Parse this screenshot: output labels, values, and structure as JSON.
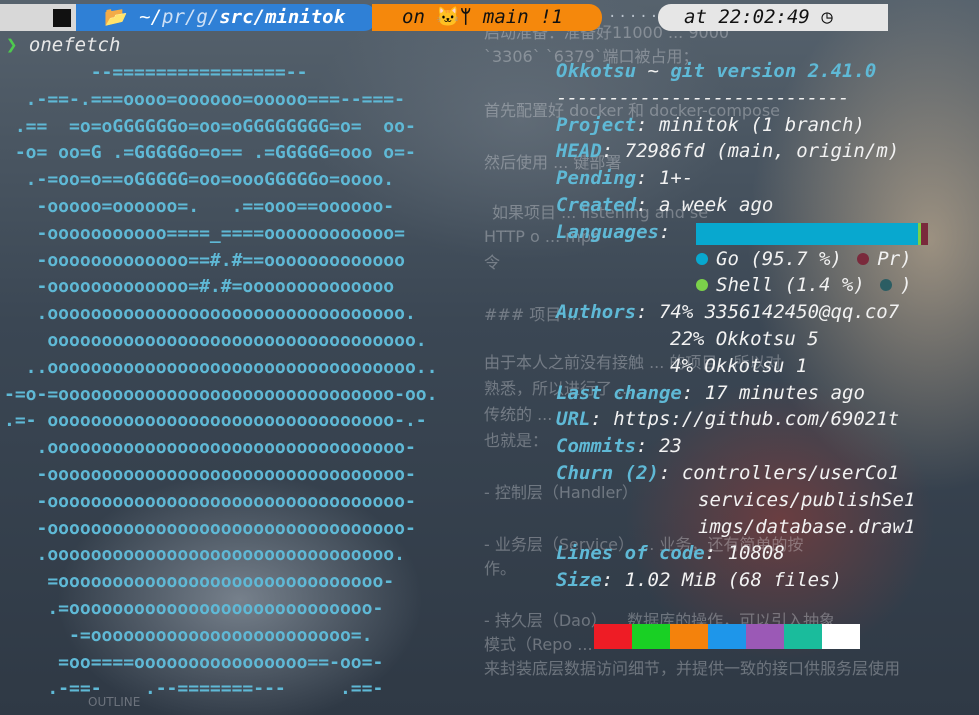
{
  "prompt": {
    "path_home": "~/",
    "path_mid": "pr/g/",
    "path_current": "src/minitok",
    "git_on": "on",
    "branch": "main",
    "git_status": "!1",
    "filler": "·········",
    "time_at": "at",
    "time": "22:02:49"
  },
  "command": "onefetch",
  "ascii": [
    "        --================--",
    "  .-==-.===oooo=oooooo=ooooo===--===-",
    " .==  =o=oGGGGGGo=oo=oGGGGGGGG=o=  oo-",
    " -o= oo=G .=GGGGGo=o== .=GGGGG=ooo o=-",
    "  .-=oo=o==oGGGGG=oo=oooGGGGGo=oooo.",
    "   -ooooo=oooooo=.   .==ooo==oooooo-",
    "   -ooooooooooo====_====oooooooooooo=",
    "   -ooooooooooooo==#.#==ooooooooooooo",
    "   -ooooooooooooo=#.#=oooooooooooooo",
    "   .ooooooooooooooooooooooooooooooooo.",
    "    oooooooooooooooooooooooooooooooooo.",
    "  ..oooooooooooooooooooooooooooooooooo..",
    "-=o-=ooooooooooooooooooooooooooooooo-oo.",
    ".=- oooooooooooooooooooooooooooooooo-.-",
    "   .ooooooooooooooooooooooooooooooooo-",
    "   -ooooooooooooooooooooooooooooooooo-",
    "   -ooooooooooooooooooooooooooooooooo-",
    "   -ooooooooooooooooooooooooooooooooo-",
    "   .oooooooooooooooooooooooooooooooo.",
    "    =oooooooooooooooooooooooooooooo-",
    "    .=oooooooooooooooooooooooooooo-",
    "      -=oooooooooooooooooooooooo=.",
    "     =oo====oooooooooooooooo==-oo=-",
    "    .-==-    .--=======---     .==-"
  ],
  "info": {
    "user": "Okkotsu",
    "tilde": "~",
    "git_version": "git version 2.41.0",
    "separator": "----------------------------",
    "project": {
      "key": "Project",
      "value": "minitok (1 branch)"
    },
    "head": {
      "key": "HEAD",
      "value": "72986fd (main, origin/m)"
    },
    "pending": {
      "key": "Pending",
      "value": "1+-"
    },
    "created": {
      "key": "Created",
      "value": "a week ago"
    },
    "languages": {
      "key": "Languages",
      "items": [
        {
          "label": "Go (95.7 %)",
          "color": "#08a8cf",
          "percent": 95.7
        },
        {
          "label": "Shell (1.4 %)",
          "color": "#7bd14a",
          "percent": 1.4
        },
        {
          "label": "Pr)",
          "color": "#7a2a3c"
        },
        {
          "label": ")",
          "color": "#2b5d63"
        }
      ]
    },
    "authors": {
      "key": "Authors",
      "items": [
        "74% 3356142450@qq.co7",
        "22% Okkotsu 5",
        "4% Okkotsu 1"
      ]
    },
    "last_change": {
      "key": "Last change",
      "value": "17 minutes ago"
    },
    "url": {
      "key": "URL",
      "value": "https://github.com/69021t"
    },
    "commits": {
      "key": "Commits",
      "value": "23"
    },
    "churn": {
      "key": "Churn (2)",
      "items": [
        "controllers/userCo1",
        "services/publishSe1",
        "imgs/database.draw1"
      ]
    },
    "loc": {
      "key": "Lines of code",
      "value": "10808"
    },
    "size": {
      "key": "Size",
      "value": "1.02 MiB (68 files)"
    }
  },
  "palette": [
    "#ee1c25",
    "#19d024",
    "#f4820c",
    "#1e96ea",
    "#9b59b6",
    "#1abc9c",
    "#ffffff"
  ],
  "ghost": {
    "l1": "启动准备：准备好11000 ... 9000",
    "l2": "`3306`  `6379`端口被占用；",
    "l3": "首先配置好 docker 和 docker-compose",
    "l4": "然后使用 ... 键部署",
    "l5": "如果项目 ... listening and se",
    "l6": "HTTP o ... mpo",
    "l7": "令",
    "l8": "### 项目 ...",
    "l9": "由于本人之前没有接触 ... 的项目，所以对",
    "l10": "熟悉，所以进行了 ...",
    "l11": "传统的 ...",
    "l12": "也就是：",
    "l13": "- 控制层（Handler）",
    "l14": "- 业务层（Service） ... 业务，还有简单的按",
    "l15": "作。",
    "l16": "- 持久层（Dao）... 数据库的操作，可以引入抽象",
    "l17": "模式（Repo ...",
    "l18": "来封装底层数据访问细节，并提供一致的接口供服务层使用",
    "outline": "OUTLINE"
  }
}
